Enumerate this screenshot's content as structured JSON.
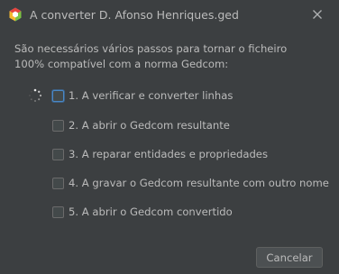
{
  "window": {
    "title": "A converter D. Afonso Henriques.ged",
    "icon": "app-logo-icon",
    "close_icon": "close-icon"
  },
  "intro": {
    "line1": "São necessários vários passos para tornar o ficheiro",
    "line2": "100% compatível com a norma Gedcom:"
  },
  "steps": [
    {
      "label": "1. A verificar e converter linhas",
      "checked": false,
      "active": true
    },
    {
      "label": "2. A abrir o Gedcom resultante",
      "checked": false,
      "active": false
    },
    {
      "label": "3. A reparar entidades e propriedades",
      "checked": false,
      "active": false
    },
    {
      "label": "4. A gravar o Gedcom resultante com outro nome",
      "checked": false,
      "active": false
    },
    {
      "label": "5. A abrir o Gedcom convertido",
      "checked": false,
      "active": false
    }
  ],
  "buttons": {
    "cancel": "Cancelar"
  },
  "colors": {
    "background": "#3c3f41",
    "text": "#bbbbbb",
    "focus": "#4a88c7"
  }
}
